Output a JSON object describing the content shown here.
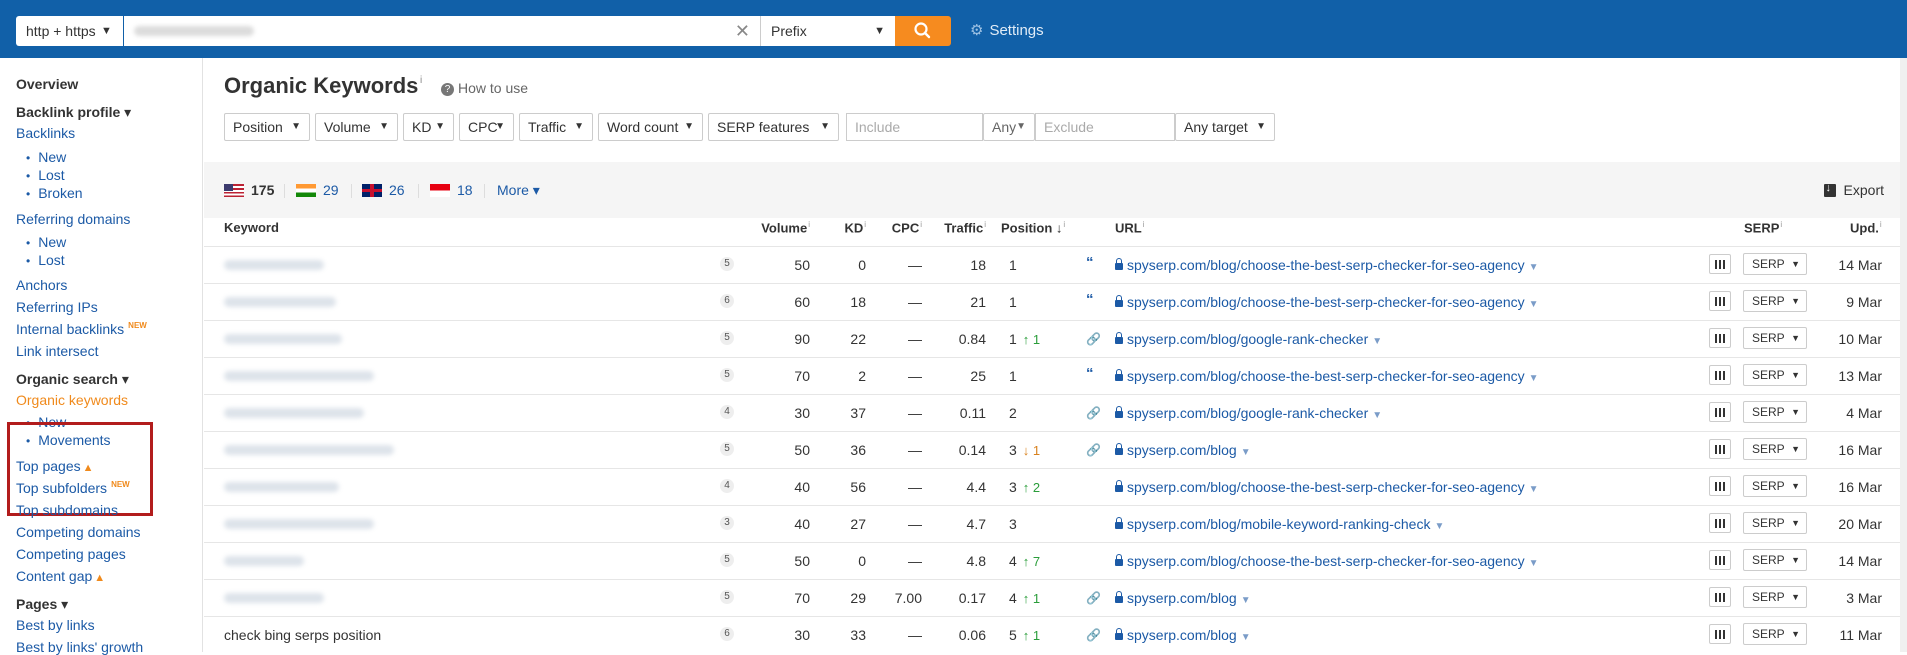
{
  "topbar": {
    "protocol": "http + https",
    "mode": "Prefix",
    "settings_label": "Settings",
    "brand_color": "#1160a8",
    "accent_color": "#f68b1f"
  },
  "sidebar": {
    "overview": "Overview",
    "backlink_profile": "Backlink profile ▾",
    "backlinks": "Backlinks",
    "bl_new": "New",
    "bl_lost": "Lost",
    "bl_broken": "Broken",
    "referring_domains": "Referring domains",
    "rd_new": "New",
    "rd_lost": "Lost",
    "anchors": "Anchors",
    "referring_ips": "Referring IPs",
    "internal_backlinks": "Internal backlinks",
    "new_badge": "NEW",
    "link_intersect": "Link intersect",
    "organic_search": "Organic search ▾",
    "organic_keywords": "Organic keywords",
    "ok_new": "New",
    "ok_movements": "Movements",
    "top_pages": "Top pages",
    "top_subfolders": "Top subfolders",
    "top_subdomains": "Top subdomains",
    "competing_domains": "Competing domains",
    "competing_pages": "Competing pages",
    "content_gap": "Content gap",
    "pages": "Pages ▾",
    "best_by_links": "Best by links",
    "best_by_links_growth": "Best by links' growth"
  },
  "main": {
    "title": "Organic Keywords",
    "title_info": "i",
    "how_to_use": "How to use",
    "filters": {
      "position": "Position",
      "volume": "Volume",
      "kd": "KD",
      "cpc": "CPC",
      "traffic": "Traffic",
      "word_count": "Word count",
      "serp_features": "SERP features",
      "include_placeholder": "Include",
      "any": "Any",
      "exclude_placeholder": "Exclude",
      "any_target": "Any target"
    },
    "countries": [
      {
        "flag": "us",
        "count": "175"
      },
      {
        "flag": "in",
        "count": "29"
      },
      {
        "flag": "gb",
        "count": "26"
      },
      {
        "flag": "id",
        "count": "18"
      }
    ],
    "more": "More ▾",
    "export": "Export",
    "columns": {
      "keyword": "Keyword",
      "volume": "Volume",
      "kd": "KD",
      "cpc": "CPC",
      "traffic": "Traffic",
      "position": "Position",
      "url": "URL",
      "serp": "SERP",
      "upd": "Upd."
    },
    "rows": [
      {
        "serp_n": "5",
        "volume": "50",
        "kd": "0",
        "cpc": "—",
        "traffic": "18",
        "pos": "1",
        "chg": "",
        "chg_dir": "",
        "icon": "quote-icon",
        "url": "spyserp.com/blog/choose-the-best-serp-checker-for-seo-agency",
        "serp_btn": "SERP",
        "upd": "14 Mar",
        "kw": ""
      },
      {
        "serp_n": "6",
        "volume": "60",
        "kd": "18",
        "cpc": "—",
        "traffic": "21",
        "pos": "1",
        "chg": "",
        "chg_dir": "",
        "icon": "quote-icon",
        "url": "spyserp.com/blog/choose-the-best-serp-checker-for-seo-agency",
        "serp_btn": "SERP",
        "upd": "9 Mar",
        "kw": ""
      },
      {
        "serp_n": "5",
        "volume": "90",
        "kd": "22",
        "cpc": "—",
        "traffic": "0.84",
        "pos": "1",
        "chg": "↑ 1",
        "chg_dir": "up",
        "icon": "link-icon",
        "url": "spyserp.com/blog/google-rank-checker",
        "serp_btn": "SERP",
        "upd": "10 Mar",
        "kw": ""
      },
      {
        "serp_n": "5",
        "volume": "70",
        "kd": "2",
        "cpc": "—",
        "traffic": "25",
        "pos": "1",
        "chg": "",
        "chg_dir": "",
        "icon": "quote-icon",
        "url": "spyserp.com/blog/choose-the-best-serp-checker-for-seo-agency",
        "serp_btn": "SERP",
        "upd": "13 Mar",
        "kw": ""
      },
      {
        "serp_n": "4",
        "volume": "30",
        "kd": "37",
        "cpc": "—",
        "traffic": "0.11",
        "pos": "2",
        "chg": "",
        "chg_dir": "",
        "icon": "link-icon",
        "url": "spyserp.com/blog/google-rank-checker",
        "serp_btn": "SERP",
        "upd": "4 Mar",
        "kw": ""
      },
      {
        "serp_n": "5",
        "volume": "50",
        "kd": "36",
        "cpc": "—",
        "traffic": "0.14",
        "pos": "3",
        "chg": "↓ 1",
        "chg_dir": "down",
        "icon": "link-icon",
        "url": "spyserp.com/blog",
        "serp_btn": "SERP",
        "upd": "16 Mar",
        "kw": ""
      },
      {
        "serp_n": "4",
        "volume": "40",
        "kd": "56",
        "cpc": "—",
        "traffic": "4.4",
        "pos": "3",
        "chg": "↑ 2",
        "chg_dir": "up",
        "icon": "",
        "url": "spyserp.com/blog/choose-the-best-serp-checker-for-seo-agency",
        "serp_btn": "SERP",
        "upd": "16 Mar",
        "kw": ""
      },
      {
        "serp_n": "3",
        "volume": "40",
        "kd": "27",
        "cpc": "—",
        "traffic": "4.7",
        "pos": "3",
        "chg": "",
        "chg_dir": "",
        "icon": "",
        "url": "spyserp.com/blog/mobile-keyword-ranking-check",
        "serp_btn": "SERP",
        "upd": "20 Mar",
        "kw": ""
      },
      {
        "serp_n": "5",
        "volume": "50",
        "kd": "0",
        "cpc": "—",
        "traffic": "4.8",
        "pos": "4",
        "chg": "↑ 7",
        "chg_dir": "up",
        "icon": "",
        "url": "spyserp.com/blog/choose-the-best-serp-checker-for-seo-agency",
        "serp_btn": "SERP",
        "upd": "14 Mar",
        "kw": ""
      },
      {
        "serp_n": "5",
        "volume": "70",
        "kd": "29",
        "cpc": "7.00",
        "traffic": "0.17",
        "pos": "4",
        "chg": "↑ 1",
        "chg_dir": "up",
        "icon": "link-icon",
        "url": "spyserp.com/blog",
        "serp_btn": "SERP",
        "upd": "3 Mar",
        "kw": ""
      },
      {
        "serp_n": "6",
        "volume": "30",
        "kd": "33",
        "cpc": "—",
        "traffic": "0.06",
        "pos": "5",
        "chg": "↑ 1",
        "chg_dir": "up",
        "icon": "link-icon",
        "url": "spyserp.com/blog",
        "serp_btn": "SERP",
        "upd": "11 Mar",
        "kw": "check bing serps position"
      }
    ]
  }
}
